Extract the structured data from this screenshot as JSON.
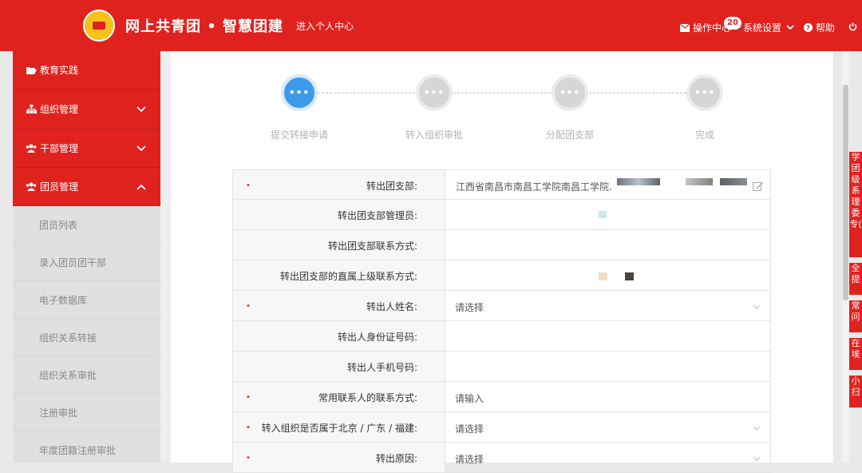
{
  "header": {
    "brand": "网上共青团 • 智慧团建",
    "enter_personal_center": "进入个人中心",
    "operation_center": "操作中心",
    "badge_count": "20",
    "system_settings": "系统设置",
    "help": "帮助"
  },
  "sidebar": {
    "items": [
      {
        "label": "教育实践",
        "icon": "folder-open-icon"
      },
      {
        "label": "组织管理",
        "icon": "sitemap-icon"
      },
      {
        "label": "干部管理",
        "icon": "users-icon"
      },
      {
        "label": "团员管理",
        "icon": "users-icon"
      }
    ],
    "sub_items": [
      "团员列表",
      "录入团员团干部",
      "电子数据库",
      "组织关系转接",
      "组织关系审批",
      "注册审批",
      "年度团籍注册审批"
    ]
  },
  "steps": {
    "dots": "•••",
    "labels": [
      "提交转接申请",
      "转入组织审批",
      "分配团支部",
      "完成"
    ],
    "active_index": 0
  },
  "form": {
    "rows": [
      {
        "label": "转出团支部:",
        "required": true,
        "value": "江西省南昌市南昌工学院南昌工学院."
      },
      {
        "label": "转出团支部管理员:",
        "required": false,
        "value": ""
      },
      {
        "label": "转出团支部联系方式:",
        "required": false,
        "value": ""
      },
      {
        "label": "转出团支部的直属上级联系方式:",
        "required": false,
        "value": ""
      },
      {
        "label": "转出人姓名:",
        "required": true,
        "value": "请选择"
      },
      {
        "label": "转出人身份证号码:",
        "required": false,
        "value": ""
      },
      {
        "label": "转出人手机号码:",
        "required": false,
        "value": ""
      },
      {
        "label": "常用联系人的联系方式:",
        "required": true,
        "value": "请输入"
      },
      {
        "label": "转入组织是否属于北京 / 广东 / 福建:",
        "required": true,
        "value": "请选择"
      },
      {
        "label": "转出原因:",
        "required": true,
        "value": "请选择"
      }
    ],
    "required_mark": "•"
  },
  "right_tabs": [
    "学团级系理委专(",
    "全提",
    "常问",
    "在埃",
    "小扫"
  ],
  "colors": {
    "brand_red": "#e0221f",
    "step_active": "#3c9be8",
    "step_inactive": "#d6d6d6"
  }
}
